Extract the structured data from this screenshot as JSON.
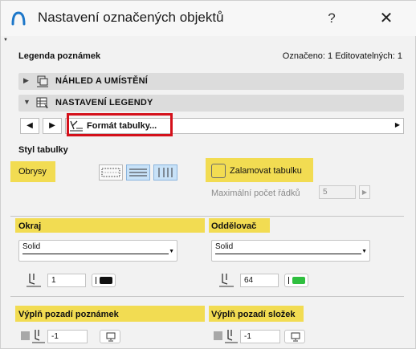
{
  "window": {
    "title": "Nastavení označených objektů",
    "help": "?",
    "close": "✕"
  },
  "header": {
    "label": "Legenda poznámek",
    "status": "Označeno: 1 Editovatelných: 1"
  },
  "sections": [
    {
      "label": "NÁHLED A UMÍSTĚNÍ",
      "expanded": false,
      "icon": "preview-placement-icon"
    },
    {
      "label": "NASTAVENÍ LEGENDY",
      "expanded": true,
      "icon": "legend-settings-icon"
    }
  ],
  "nav": {
    "prev": "◀",
    "next": "▶",
    "current": "Formát tabulky...",
    "dropdown_arrow": "▶"
  },
  "table_style": {
    "heading": "Styl tabulky",
    "outline_label": "Obrysy",
    "style_buttons": [
      "table-outline-icon",
      "table-horizontal-lines-icon",
      "table-vertical-lines-icon"
    ],
    "active_style_buttons": [
      1,
      2
    ],
    "wrap_label": "Zalamovat tabulku",
    "wrap_checked": false,
    "max_rows_label": "Maximální počet řádků",
    "max_rows_value": "5",
    "max_rows_arrow": "▶"
  },
  "border": {
    "heading": "Okraj",
    "line_type": "Solid",
    "pen_number": "1",
    "pen_color": "#111111"
  },
  "separator": {
    "heading": "Oddělovač",
    "line_type": "Solid",
    "pen_number": "64",
    "pen_color": "#2fbf3f"
  },
  "note_bg_fill": {
    "heading": "Výplň pozadí poznámek",
    "pen_number": "-1"
  },
  "component_bg_fill": {
    "heading": "Výplň pozadí složek",
    "pen_number": "-1"
  },
  "colors": {
    "highlight": "#f2dc52",
    "red_frame": "#d4101a",
    "accent_blue": "#1d77c9"
  },
  "dropdown_arrow": "▼"
}
